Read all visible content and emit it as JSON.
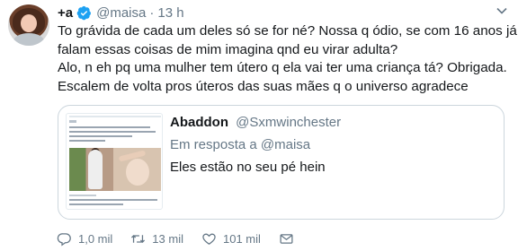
{
  "author": {
    "display_name": "+a",
    "handle": "@maisa",
    "separator": "·",
    "time": "13 h"
  },
  "tweet": {
    "lines": [
      "To grávida de cada um deles só se for né? Nossa q ódio, se com 16 anos já",
      "falam essas coisas de mim imagina qnd eu virar adulta?",
      "Alo, n eh pq uma mulher tem útero q ela vai ter uma criança tá? Obrigada.",
      "Escalem de volta pros úteros das suas mães q o universo agradece"
    ]
  },
  "quote": {
    "display_name": "Abaddon",
    "handle": "@Sxmwinchester",
    "reply_to": "Em resposta a @maisa",
    "text": "Eles estão no seu pé hein"
  },
  "actions": {
    "replies": "1,0 mil",
    "retweets": "13 mil",
    "likes": "101 mil"
  },
  "icons": [
    "verified-icon",
    "chevron-down-icon",
    "reply-icon",
    "retweet-icon",
    "like-icon",
    "direct-message-icon"
  ],
  "colors": {
    "verified": "#1da1f2",
    "secondary_text": "#657786",
    "border": "#ccd6dd"
  }
}
